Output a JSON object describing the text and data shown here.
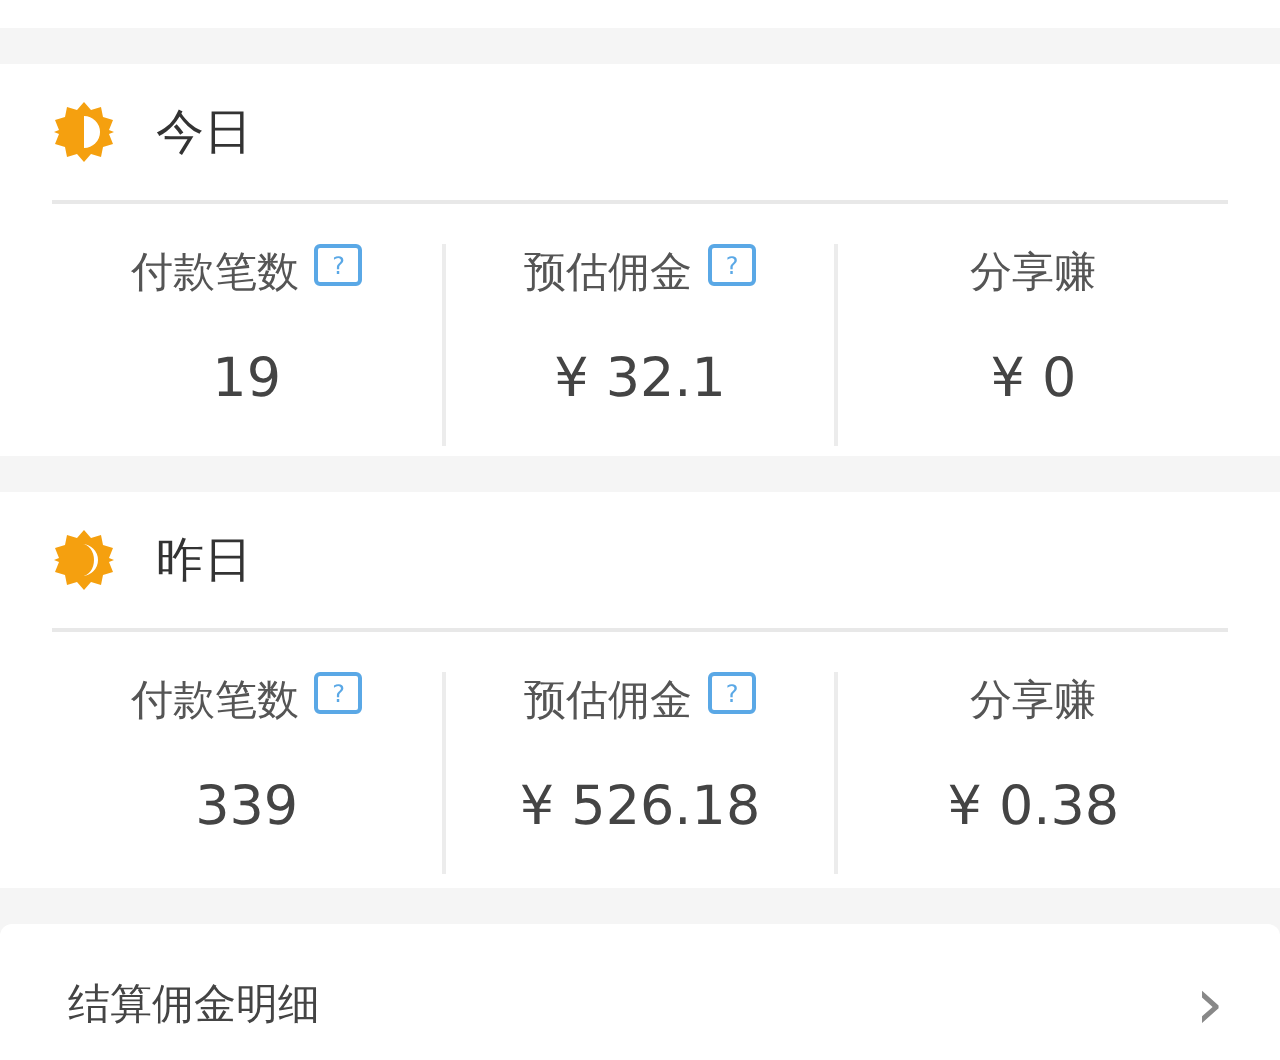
{
  "sections": [
    {
      "title": "今日",
      "stats": [
        {
          "label": "付款笔数",
          "help": "?",
          "value": "19"
        },
        {
          "label": "预估佣金",
          "help": "?",
          "value": "¥ 32.1"
        },
        {
          "label": "分享赚",
          "value": "¥ 0"
        }
      ]
    },
    {
      "title": "昨日",
      "stats": [
        {
          "label": "付款笔数",
          "help": "?",
          "value": "339"
        },
        {
          "label": "预估佣金",
          "help": "?",
          "value": "¥ 526.18"
        },
        {
          "label": "分享赚",
          "value": "¥ 0.38"
        }
      ]
    }
  ],
  "link_row": {
    "label": "结算佣金明细",
    "chevron": "›"
  }
}
